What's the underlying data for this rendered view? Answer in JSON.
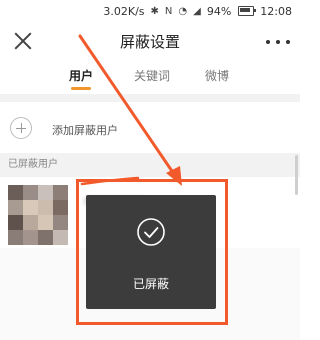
{
  "status_bar": {
    "speed": "3.02K/s",
    "battery_percent": "94%",
    "time": "12:08",
    "icons": [
      "bluetooth-icon",
      "nfc-icon",
      "wifi-icon",
      "signal-icon",
      "battery-icon"
    ]
  },
  "header": {
    "title": "屏蔽设置",
    "close_icon": "close-icon",
    "more_icon": "more-icon"
  },
  "tabs": [
    {
      "label": "用户",
      "active": true
    },
    {
      "label": "关键词",
      "active": false
    },
    {
      "label": "微博",
      "active": false
    }
  ],
  "add_row": {
    "label": "添加屏蔽用户",
    "icon": "plus-circle-icon"
  },
  "section_header": "已屏蔽用户",
  "toast": {
    "label": "已屏蔽",
    "icon": "check-circle-icon"
  },
  "colors": {
    "accent": "#f0962b",
    "annotation": "#f25a2c",
    "toast_bg": "#3c3c3c",
    "section_bg": "#f2f2f2"
  },
  "avatar_pixels": [
    "#6b5e58",
    "#9a8d87",
    "#c9c0bb",
    "#8d7f77",
    "#a89b92",
    "#d8c9b8",
    "#cbbcae",
    "#7b6a62",
    "#5f514c",
    "#b9a99c",
    "#d6c6b5",
    "#948680",
    "#8a7c76",
    "#a3958e",
    "#7f716b",
    "#c4bab3"
  ]
}
